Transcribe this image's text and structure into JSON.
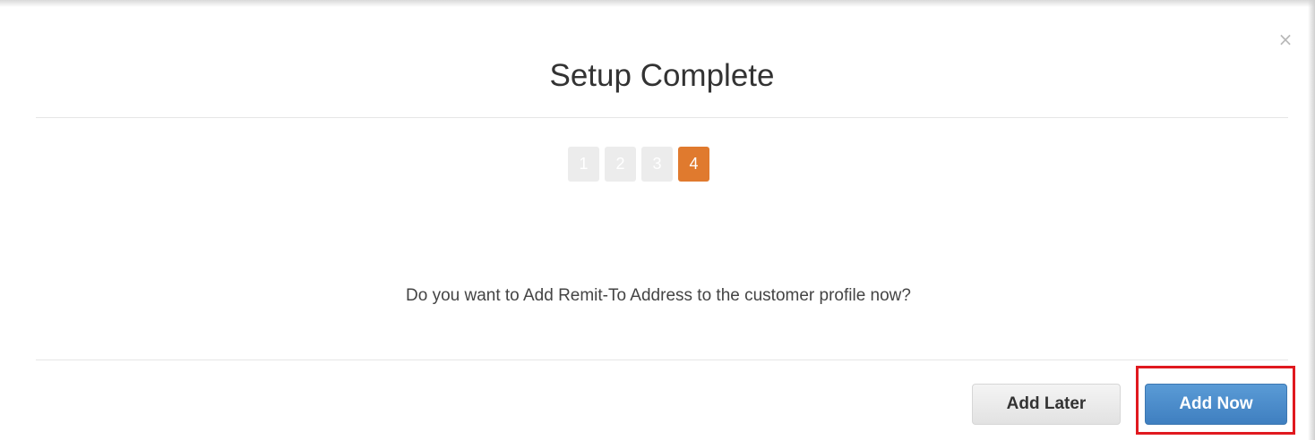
{
  "dialog": {
    "title": "Setup Complete",
    "close_icon": "close-icon",
    "close_glyph": "×",
    "steps": [
      "1",
      "2",
      "3",
      "4"
    ],
    "active_step": "4",
    "question": "Do you want to Add Remit-To Address to the customer profile now?",
    "buttons": {
      "add_later": "Add Later",
      "add_now": "Add Now"
    }
  },
  "colors": {
    "active_step": "#e07a2e",
    "inactive_step": "#ececec",
    "primary_button": "#4a8ccb",
    "highlight": "#e0191f"
  }
}
